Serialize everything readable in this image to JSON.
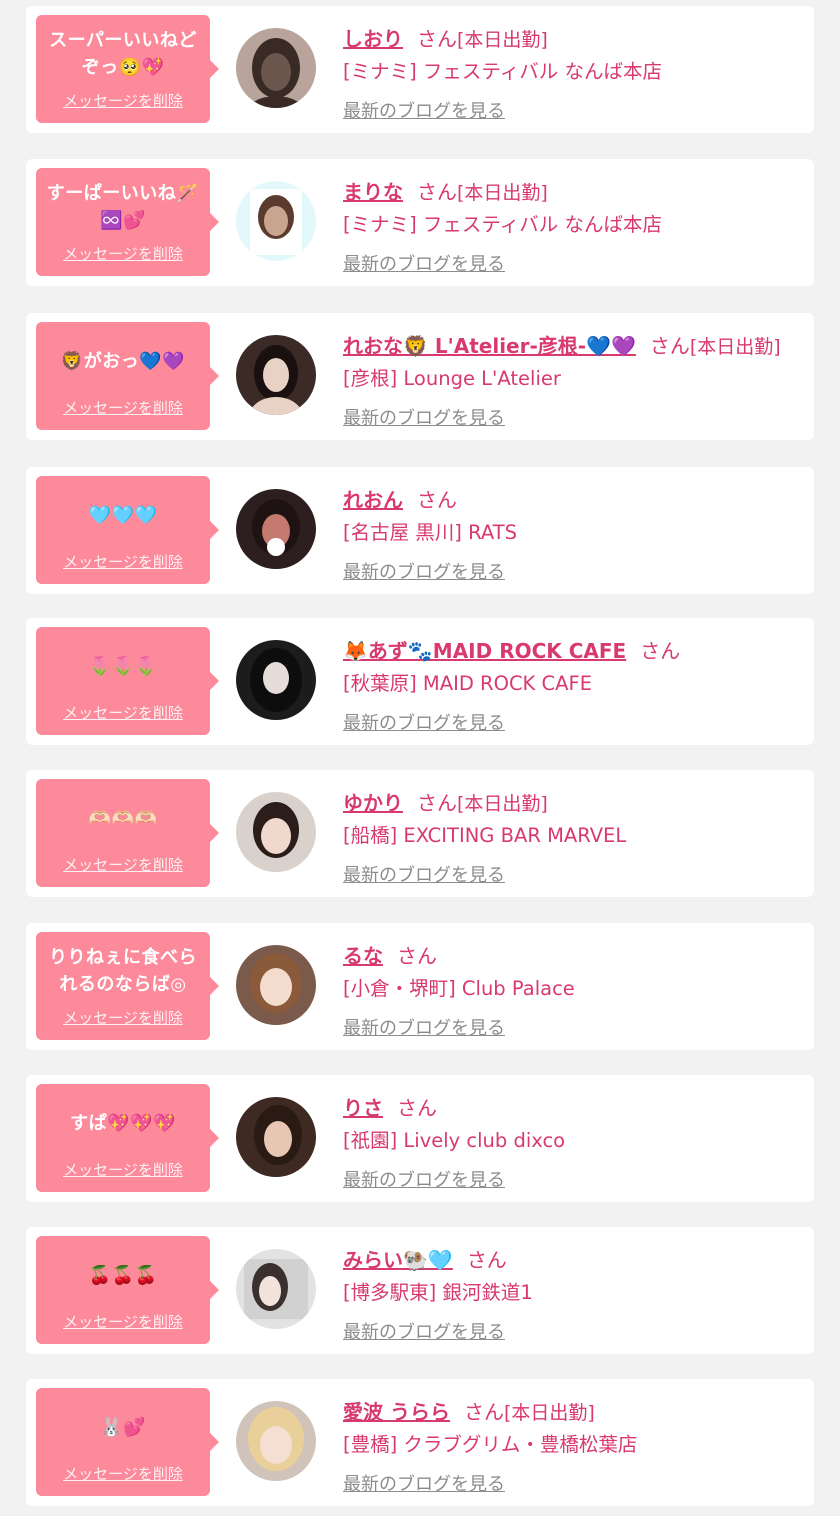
{
  "delete_label": "メッセージを削除",
  "blog_label": "最新のブログを見る",
  "san_label": "さん",
  "today_label": "[本日出勤]",
  "colors": {
    "bubble": "#fd8a9b",
    "name": "#d83a6e",
    "link_gray": "#8c8c8c",
    "background": "#f2f2f2"
  },
  "items": [
    {
      "message": "スーパーいいねど\nぞっ🥺💖",
      "name": "しおり",
      "today": true,
      "shop": "[ミナミ] フェスティバル なんば本店",
      "avatar": {
        "bg": "#b8a49a",
        "fg": "#6b564e",
        "hair": "#3a2a25"
      }
    },
    {
      "message": "すーぱーいいね🪄\n♾️💕",
      "name": "まりな",
      "today": true,
      "shop": "[ミナミ] フェスティバル なんば本店",
      "avatar": {
        "bg": "#e3f8fb",
        "fg": "#c9a48f",
        "hair": "#5a3b2d"
      }
    },
    {
      "message": "🦁がおっ💙💜",
      "name": "れおな🦁 L'Atelier-彦根-💙💜",
      "today": true,
      "shop": "[彦根] Lounge L'Atelier",
      "avatar": {
        "bg": "#3b2a26",
        "fg": "#e8d2c6",
        "hair": "#1a1010"
      }
    },
    {
      "message": "🩵🩵🩵",
      "name": "れおん",
      "today": false,
      "shop": "[名古屋 黒川] RATS",
      "avatar": {
        "bg": "#2d1f1f",
        "fg": "#c47a6e",
        "hair": "#1e1212"
      }
    },
    {
      "message": "🌷🌷🌷",
      "name": "🦊あず🐾MAID ROCK CAFE",
      "today": false,
      "shop": "[秋葉原] MAID ROCK CAFE",
      "avatar": {
        "bg": "#1c1c1c",
        "fg": "#e6dcd8",
        "hair": "#0d0d0d"
      }
    },
    {
      "message": "🫶🏻🫶🏻🫶🏻",
      "name": "ゆかり",
      "today": true,
      "shop": "[船橋] EXCITING BAR MARVEL",
      "avatar": {
        "bg": "#d9d2cc",
        "fg": "#f0d9cc",
        "hair": "#2b1e1a"
      }
    },
    {
      "message": "りりねぇに食べら\nれるのならば◎",
      "name": "るな",
      "today": false,
      "shop": "[小倉・堺町] Club Palace",
      "avatar": {
        "bg": "#7a5a4a",
        "fg": "#f3dccd",
        "hair": "#8a5a3a"
      }
    },
    {
      "message": "すぱ💖💖💖",
      "name": "りさ",
      "today": false,
      "shop": "[祇園] Lively club dixco",
      "avatar": {
        "bg": "#3e2a22",
        "fg": "#e8c6b4",
        "hair": "#2a1a14"
      }
    },
    {
      "message": "🍒🍒🍒",
      "name": "みらい🐏🩵",
      "today": false,
      "shop": "[博多駅東] 銀河鉄道1",
      "avatar": {
        "bg": "#e2e2e2",
        "fg": "#f2e4dc",
        "hair": "#3a3030"
      }
    },
    {
      "message": "🐰💕",
      "name": "愛波 うらら",
      "today": true,
      "shop": "[豊橋] クラブグリム・豊橋松葉店",
      "avatar": {
        "bg": "#cfc3ba",
        "fg": "#f4dfd2",
        "hair": "#e9cf9a"
      }
    }
  ]
}
